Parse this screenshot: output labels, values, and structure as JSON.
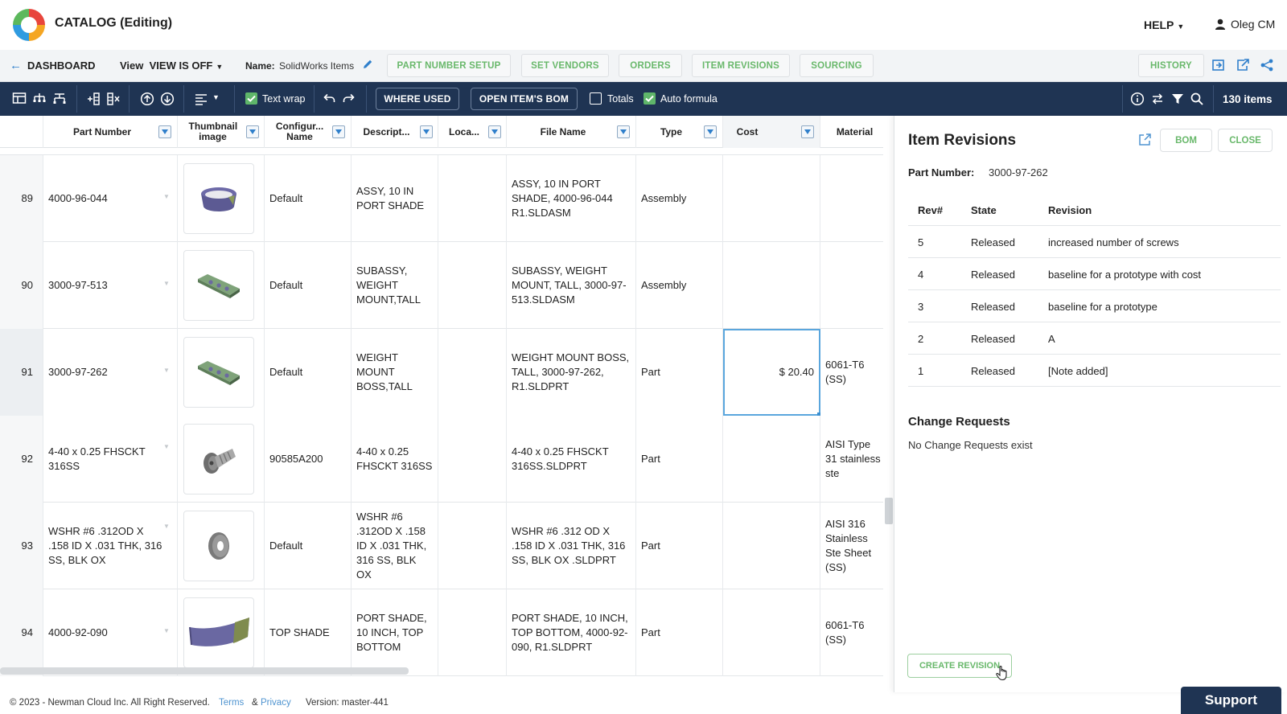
{
  "header": {
    "app_title": "CATALOG (Editing)",
    "help_label": "HELP",
    "user_name": "Oleg CM",
    "logo_colors": [
      "#e8453c",
      "#f5a623",
      "#2f9be0",
      "#5cb85c"
    ]
  },
  "nav": {
    "dashboard_label": "DASHBOARD",
    "view_label": "View",
    "view_value": "VIEW IS OFF",
    "name_label": "Name:",
    "name_value": "SolidWorks Items",
    "buttons": [
      "PART NUMBER SETUP",
      "SET VENDORS",
      "ORDERS",
      "ITEM REVISIONS",
      "SOURCING"
    ],
    "history_label": "HISTORY"
  },
  "toolbar": {
    "text_wrap_label": "Text wrap",
    "text_wrap_checked": true,
    "where_used_label": "WHERE USED",
    "open_bom_label": "OPEN ITEM'S BOM",
    "totals_label": "Totals",
    "totals_checked": false,
    "auto_formula_label": "Auto formula",
    "auto_formula_checked": true,
    "item_count": "130 items"
  },
  "grid": {
    "columns": [
      {
        "label": "Part Number"
      },
      {
        "label": "Thumbnail image"
      },
      {
        "label": "Configur... Name"
      },
      {
        "label": "Descript..."
      },
      {
        "label": "Loca..."
      },
      {
        "label": "File Name"
      },
      {
        "label": "Type"
      },
      {
        "label": "Cost"
      },
      {
        "label": "Material"
      }
    ],
    "rows": [
      {
        "num": "89",
        "part": "4000-96-044",
        "thumb": "ring-icon",
        "config": "Default",
        "desc": "ASSY, 10 IN PORT SHADE",
        "loc": "",
        "file": "ASSY, 10 IN PORT SHADE, 4000-96-044 R1.SLDASM",
        "type": "Assembly",
        "cost": "",
        "material": ""
      },
      {
        "num": "90",
        "part": "3000-97-513",
        "thumb": "bar-icon",
        "config": "Default",
        "desc": "SUBASSY, WEIGHT MOUNT,TALL",
        "loc": "",
        "file": "SUBASSY, WEIGHT MOUNT, TALL, 3000-97-513.SLDASM",
        "type": "Assembly",
        "cost": "",
        "material": ""
      },
      {
        "num": "91",
        "part": "3000-97-262",
        "thumb": "bar-icon",
        "config": "Default",
        "desc": "WEIGHT MOUNT BOSS,TALL",
        "loc": "",
        "file": "WEIGHT MOUNT BOSS, TALL, 3000-97-262, R1.SLDPRT",
        "type": "Part",
        "cost": "$ 20.40",
        "material": "6061-T6 (SS)"
      },
      {
        "num": "92",
        "part": "4-40 x 0.25 FHSCKT 316SS",
        "thumb": "screw-icon",
        "config": "90585A200",
        "desc": "4-40 x 0.25 FHSCKT 316SS",
        "loc": "",
        "file": "4-40 x 0.25 FHSCKT 316SS.SLDPRT",
        "type": "Part",
        "cost": "",
        "material": "AISI Type 31 stainless ste"
      },
      {
        "num": "93",
        "part": "WSHR #6 .312OD X .158 ID X .031 THK, 316 SS, BLK OX",
        "thumb": "washer-icon",
        "config": "Default",
        "desc": "WSHR #6 .312OD X .158 ID X .031 THK, 316 SS, BLK OX",
        "loc": "",
        "file": "WSHR #6 .312 OD X .158 ID X .031 THK, 316 SS, BLK OX .SLDPRT",
        "type": "Part",
        "cost": "",
        "material": "AISI 316 Stainless Ste Sheet (SS)"
      },
      {
        "num": "94",
        "part": "4000-92-090",
        "thumb": "shade-icon",
        "config": "TOP SHADE",
        "desc": "PORT SHADE, 10 INCH, TOP BOTTOM",
        "loc": "",
        "file": "PORT SHADE, 10 INCH, TOP BOTTOM, 4000-92-090, R1.SLDPRT",
        "type": "Part",
        "cost": "",
        "material": "6061-T6 (SS)"
      }
    ]
  },
  "panel": {
    "title": "Item Revisions",
    "bom_label": "BOM",
    "close_label": "CLOSE",
    "part_number_label": "Part Number:",
    "part_number_value": "3000-97-262",
    "rev_headers": [
      "Rev#",
      "State",
      "Revision"
    ],
    "revisions": [
      {
        "rev": "5",
        "state": "Released",
        "revision": "increased number of screws"
      },
      {
        "rev": "4",
        "state": "Released",
        "revision": "baseline for a prototype with cost"
      },
      {
        "rev": "3",
        "state": "Released",
        "revision": "baseline for a prototype"
      },
      {
        "rev": "2",
        "state": "Released",
        "revision": "A"
      },
      {
        "rev": "1",
        "state": "Released",
        "revision": "[Note added]"
      }
    ],
    "change_requests_title": "Change Requests",
    "change_requests_empty": "No Change Requests exist",
    "create_revision_label": "CREATE REVISION"
  },
  "footer": {
    "copyright": "© 2023 - Newman Cloud Inc. All Right Reserved.",
    "terms": "Terms",
    "amp": "&",
    "privacy": "Privacy",
    "version": "Version: master-441",
    "support": "Support"
  }
}
